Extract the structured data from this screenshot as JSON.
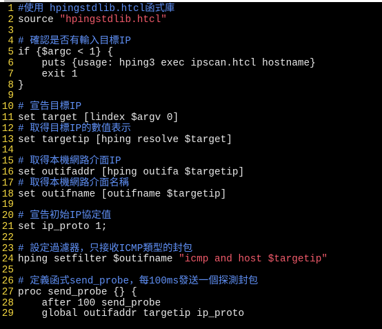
{
  "colors": {
    "background": "#000000",
    "line_number": "#f1d53f",
    "comment": "#5f8ff4",
    "string": "#f05a6a",
    "text": "#e6e6e6"
  },
  "editor": {
    "lines": [
      {
        "n": "1",
        "parts": [
          {
            "t": "#使用 hpingstdlib.htcl函式庫",
            "c": "comment"
          }
        ]
      },
      {
        "n": "2",
        "parts": [
          {
            "t": "source ",
            "c": "text"
          },
          {
            "t": "\"hpingstdlib.htcl\"",
            "c": "string"
          }
        ]
      },
      {
        "n": "3",
        "parts": []
      },
      {
        "n": "4",
        "parts": [
          {
            "t": "# 確認是否有輸入目標IP",
            "c": "comment"
          }
        ]
      },
      {
        "n": "5",
        "parts": [
          {
            "t": "if {$argc < 1} {",
            "c": "text"
          }
        ]
      },
      {
        "n": "6",
        "parts": [
          {
            "t": "    puts {usage: hping3 exec ipscan.htcl hostname}",
            "c": "text"
          }
        ]
      },
      {
        "n": "7",
        "parts": [
          {
            "t": "    exit 1",
            "c": "text"
          }
        ]
      },
      {
        "n": "8",
        "parts": [
          {
            "t": "}",
            "c": "text"
          }
        ]
      },
      {
        "n": "9",
        "parts": []
      },
      {
        "n": "10",
        "parts": [
          {
            "t": "# 宣告目標IP",
            "c": "comment"
          }
        ]
      },
      {
        "n": "11",
        "parts": [
          {
            "t": "set target [lindex $argv 0]",
            "c": "text"
          }
        ]
      },
      {
        "n": "12",
        "parts": [
          {
            "t": "# 取得目標IP的數值表示",
            "c": "comment"
          }
        ]
      },
      {
        "n": "13",
        "parts": [
          {
            "t": "set targetip [hping resolve $target]",
            "c": "text"
          }
        ]
      },
      {
        "n": "14",
        "parts": []
      },
      {
        "n": "15",
        "parts": [
          {
            "t": "# 取得本機網路介面IP",
            "c": "comment"
          }
        ]
      },
      {
        "n": "16",
        "parts": [
          {
            "t": "set outifaddr [hping outifa $targetip]",
            "c": "text"
          }
        ]
      },
      {
        "n": "17",
        "parts": [
          {
            "t": "# 取得本機網路介面名稱",
            "c": "comment"
          }
        ]
      },
      {
        "n": "18",
        "parts": [
          {
            "t": "set outifname [outifname $targetip]",
            "c": "text"
          }
        ]
      },
      {
        "n": "19",
        "parts": []
      },
      {
        "n": "20",
        "parts": [
          {
            "t": "# 宣告初始IP協定值",
            "c": "comment"
          }
        ]
      },
      {
        "n": "21",
        "parts": [
          {
            "t": "set ip_proto 1;",
            "c": "text"
          }
        ]
      },
      {
        "n": "22",
        "parts": []
      },
      {
        "n": "23",
        "parts": [
          {
            "t": "# 設定過濾器，只接收ICMP類型的封包",
            "c": "comment"
          }
        ]
      },
      {
        "n": "24",
        "parts": [
          {
            "t": "hping setfilter $outifname ",
            "c": "text"
          },
          {
            "t": "\"icmp and host $targetip\"",
            "c": "string"
          }
        ]
      },
      {
        "n": "25",
        "parts": []
      },
      {
        "n": "26",
        "parts": [
          {
            "t": "# 定義函式send_probe，每100ms發送一個探測封包",
            "c": "comment"
          }
        ]
      },
      {
        "n": "27",
        "parts": [
          {
            "t": "proc send_probe {} {",
            "c": "text"
          }
        ]
      },
      {
        "n": "28",
        "parts": [
          {
            "t": "    after 100 send_probe",
            "c": "text"
          }
        ]
      },
      {
        "n": "29",
        "parts": [
          {
            "t": "    global outifaddr targetip ip_proto",
            "c": "text"
          }
        ]
      }
    ]
  }
}
